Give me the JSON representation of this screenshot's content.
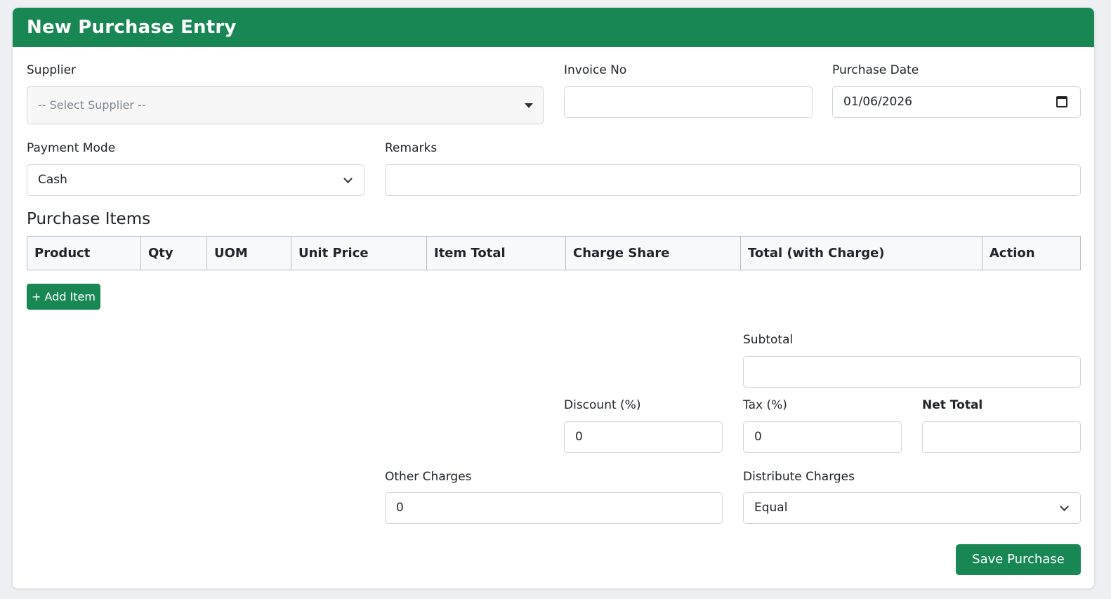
{
  "header": {
    "title": "New Purchase Entry"
  },
  "form": {
    "supplier": {
      "label": "Supplier",
      "placeholder": "-- Select Supplier --"
    },
    "invoice_no": {
      "label": "Invoice No",
      "value": ""
    },
    "purchase_date": {
      "label": "Purchase Date",
      "value": "01/06/2026"
    },
    "payment_mode": {
      "label": "Payment Mode",
      "value": "Cash"
    },
    "remarks": {
      "label": "Remarks",
      "value": ""
    }
  },
  "items": {
    "title": "Purchase Items",
    "columns": [
      "Product",
      "Qty",
      "UOM",
      "Unit Price",
      "Item Total",
      "Charge Share",
      "Total (with Charge)",
      "Action"
    ],
    "add_button": "+ Add Item"
  },
  "totals": {
    "subtotal": {
      "label": "Subtotal",
      "value": ""
    },
    "discount": {
      "label": "Discount (%)",
      "value": "0"
    },
    "tax": {
      "label": "Tax (%)",
      "value": "0"
    },
    "net_total": {
      "label": "Net Total",
      "value": ""
    },
    "other_charges": {
      "label": "Other Charges",
      "value": "0"
    },
    "distribute_charges": {
      "label": "Distribute Charges",
      "value": "Equal"
    }
  },
  "actions": {
    "save": "Save Purchase"
  },
  "colors": {
    "primary": "#198754",
    "border": "#ced4da"
  }
}
